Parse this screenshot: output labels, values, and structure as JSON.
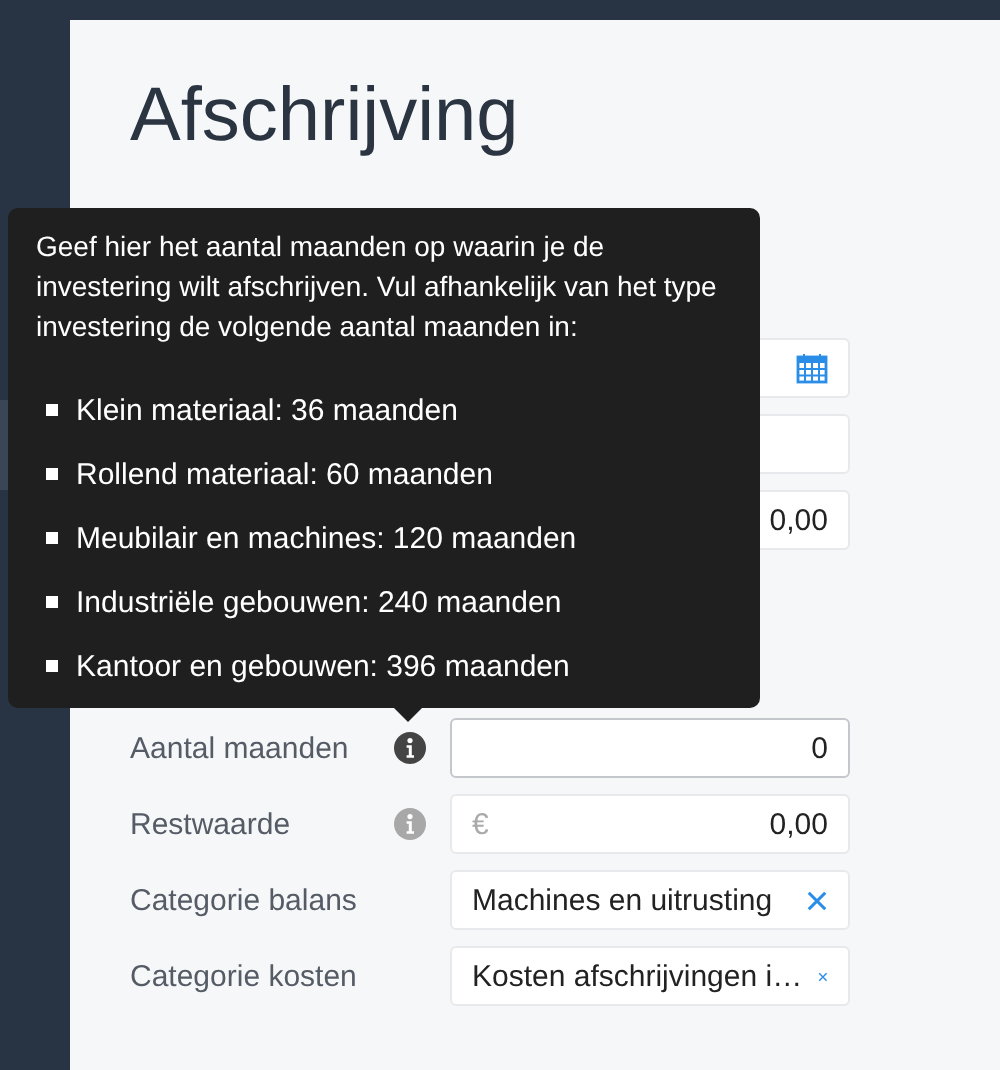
{
  "page": {
    "title": "Afschrijving"
  },
  "sections": [
    {
      "fields": [
        {
          "kind": "date"
        },
        {
          "kind": "text"
        },
        {
          "kind": "amount",
          "value": "0,00"
        }
      ]
    },
    {
      "fields": [
        {
          "label": "Aantal maanden",
          "kind": "number",
          "value": "0",
          "info_active": true,
          "focused": true
        },
        {
          "label": "Restwaarde",
          "kind": "amount",
          "currency": "€",
          "value": "0,00",
          "info_active": false,
          "focused": false
        },
        {
          "label": "Categorie balans",
          "kind": "select",
          "value": "Machines en uitrusting",
          "clearable": true
        },
        {
          "label": "Categorie kosten",
          "kind": "select",
          "value": "Kosten afschrijvingen i…",
          "clearable": true
        }
      ]
    }
  ],
  "tooltip": {
    "intro": "Geef hier het aantal maanden op waarin je de investering wilt afschrijven. Vul afhankelijk van het type investering de volgende aantal maanden in:",
    "items": [
      "Klein materiaal: 36 maanden",
      "Rollend materiaal: 60 maanden",
      "Meubilair en machines: 120 maanden",
      "Industriële gebouwen: 240 maanden",
      "Kantoor en gebouwen: 396 maanden"
    ]
  }
}
